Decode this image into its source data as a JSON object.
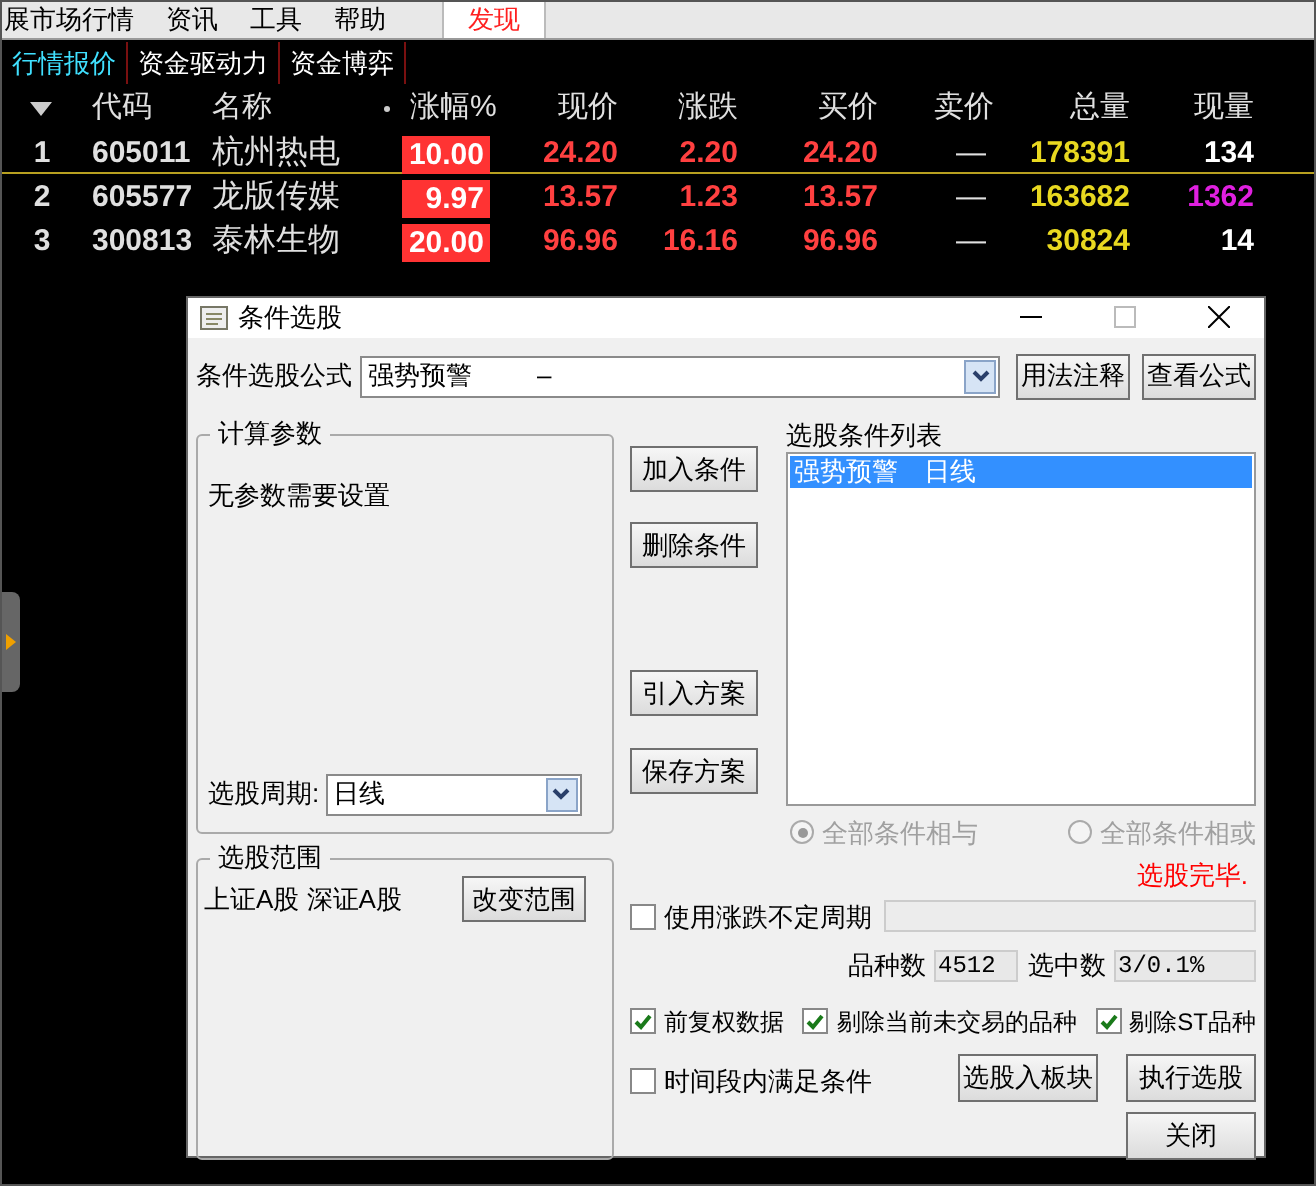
{
  "menu": [
    {
      "label": "展市场行情",
      "selected": false
    },
    {
      "label": "资讯",
      "selected": false
    },
    {
      "label": "工具",
      "selected": false
    },
    {
      "label": "帮助",
      "selected": false
    },
    {
      "label": "发现",
      "selected": true
    }
  ],
  "tabs": [
    {
      "label": "行情报价",
      "selected": true
    },
    {
      "label": "资金驱动力",
      "selected": false
    },
    {
      "label": "资金博弈",
      "selected": false
    }
  ],
  "quote_table": {
    "columns": [
      "代码",
      "名称",
      "涨幅%",
      "现价",
      "涨跌",
      "买价",
      "卖价",
      "总量",
      "现量"
    ],
    "rows": [
      {
        "index": "1",
        "code": "605011",
        "name": "杭州热电",
        "change_pct": "10.00",
        "price": "24.20",
        "change": "2.20",
        "bid": "24.20",
        "ask": "—",
        "volume": "178391",
        "last_volume": {
          "text": "134",
          "color": "#ffffff"
        },
        "selected": true
      },
      {
        "index": "2",
        "code": "605577",
        "name": "龙版传媒",
        "change_pct": "9.97",
        "price": "13.57",
        "change": "1.23",
        "bid": "13.57",
        "ask": "—",
        "volume": "163682",
        "last_volume": {
          "text": "1362",
          "color": "#e020e0"
        },
        "selected": false
      },
      {
        "index": "3",
        "code": "300813",
        "name": "泰林生物",
        "change_pct": "20.00",
        "price": "96.96",
        "change": "16.16",
        "bid": "96.96",
        "ask": "—",
        "volume": "30824",
        "last_volume": {
          "text": "14",
          "color": "#ffffff"
        },
        "selected": false
      }
    ]
  },
  "dialog": {
    "title": "条件选股",
    "formula_label": "条件选股公式",
    "formula_value": "强势预警         –",
    "top_buttons": [
      "用法注释",
      "查看公式"
    ],
    "params_group": {
      "title": "计算参数",
      "message": "无参数需要设置",
      "period_label": "选股周期:",
      "period_value": "日线"
    },
    "range_group": {
      "title": "选股范围",
      "markets": "上证A股 深证A股",
      "button": "改变范围"
    },
    "middle_buttons": [
      "加入条件",
      "删除条件",
      "引入方案",
      "保存方案"
    ],
    "list_label": "选股条件列表",
    "list_items": [
      {
        "text": "强势预警　日线",
        "selected": true
      }
    ],
    "radios_disabled": true,
    "radios": [
      {
        "label": "全部条件相与",
        "selected": true
      },
      {
        "label": "全部条件相或",
        "selected": false
      }
    ],
    "status": "选股完毕.",
    "variable_period": {
      "label": "使用涨跌不定周期",
      "checked": false
    },
    "count_label": "品种数",
    "count_value": "4512",
    "picked_label": "选中数",
    "picked_value": "3/0.1%",
    "options": [
      {
        "label": "前复权数据",
        "checked": true
      },
      {
        "label": "剔除当前未交易的品种",
        "checked": true
      },
      {
        "label": "剔除ST品种",
        "checked": true
      }
    ],
    "time_condition": {
      "label": "时间段内满足条件",
      "checked": false
    },
    "action_buttons": [
      "选股入板块",
      "执行选股",
      "关闭"
    ]
  }
}
